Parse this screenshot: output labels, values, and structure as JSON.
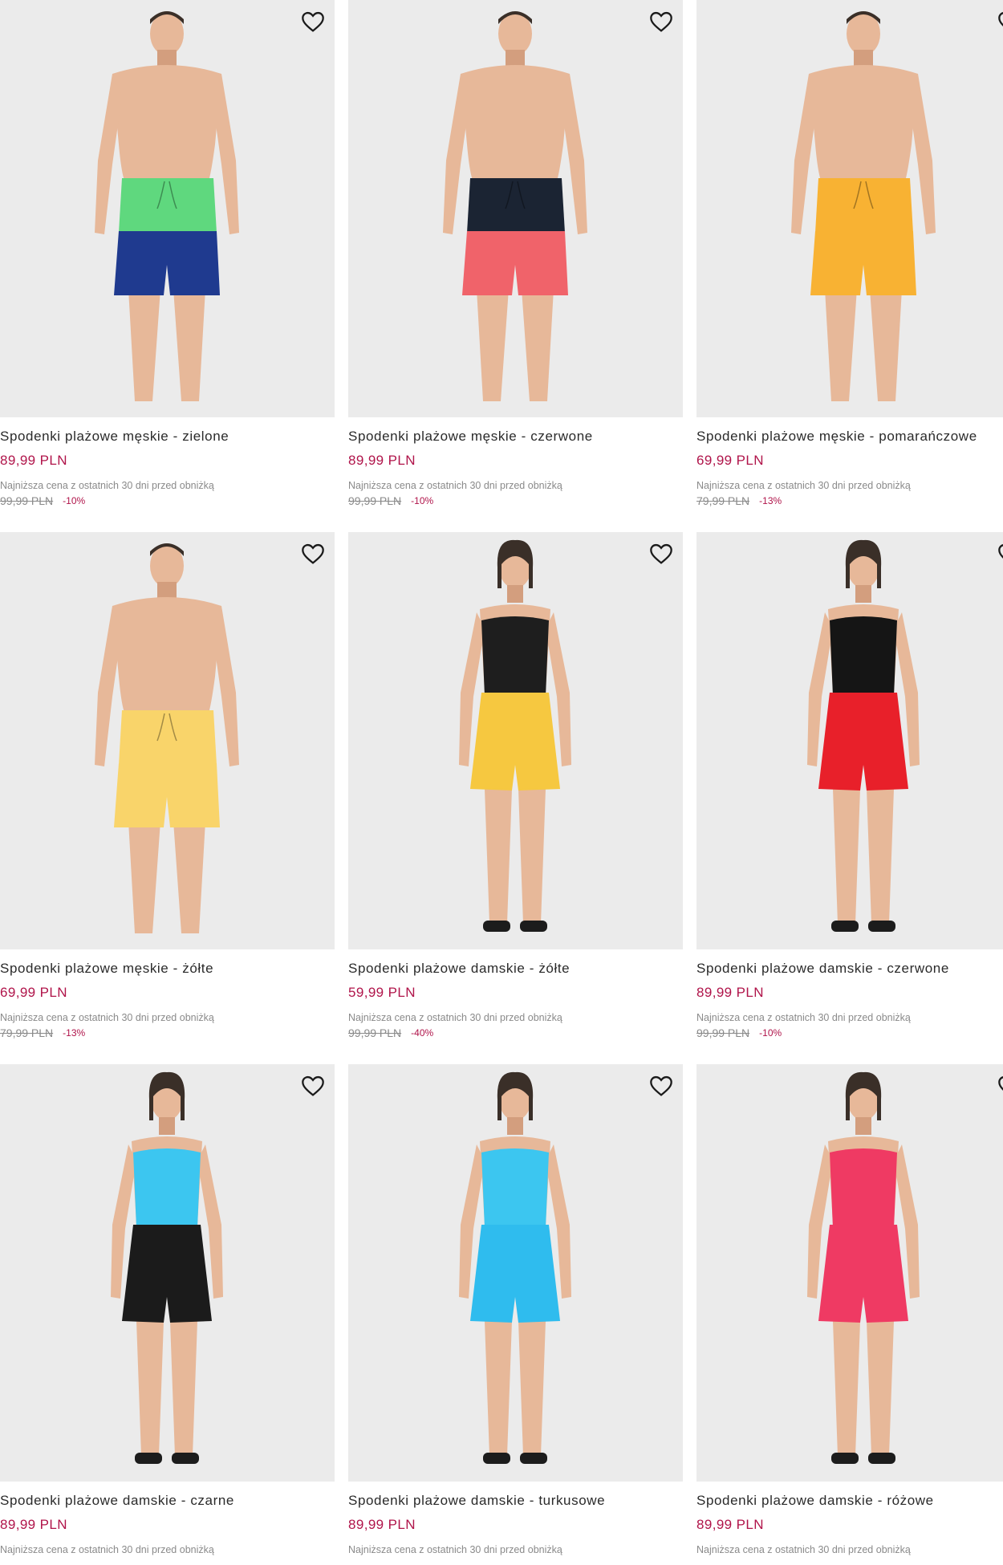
{
  "lowest_label": "Najniższa cena z ostatnich 30 dni przed obniżką",
  "products": [
    {
      "title": "Spodenki plażowe męskie - zielone",
      "price": "89,99 PLN",
      "old_price": "99,99 PLN",
      "discount": "-10%",
      "gender": "male",
      "top_color": "#5fd87e",
      "bottom_color": "#1f3a8f",
      "shirt_color": ""
    },
    {
      "title": "Spodenki plażowe męskie - czerwone",
      "price": "89,99 PLN",
      "old_price": "99,99 PLN",
      "discount": "-10%",
      "gender": "male",
      "top_color": "#1b2433",
      "bottom_color": "#f0636a",
      "shirt_color": ""
    },
    {
      "title": "Spodenki plażowe męskie - pomarańczowe",
      "price": "69,99 PLN",
      "old_price": "79,99 PLN",
      "discount": "-13%",
      "gender": "male",
      "top_color": "#f8b233",
      "bottom_color": "#f8b233",
      "shirt_color": ""
    },
    {
      "title": "Spodenki plażowe męskie - żółte",
      "price": "69,99 PLN",
      "old_price": "79,99 PLN",
      "discount": "-13%",
      "gender": "male",
      "top_color": "#f9d46a",
      "bottom_color": "#f9d46a",
      "shirt_color": ""
    },
    {
      "title": "Spodenki plażowe damskie - żółte",
      "price": "59,99 PLN",
      "old_price": "99,99 PLN",
      "discount": "-40%",
      "gender": "female",
      "top_color": "#f6c840",
      "bottom_color": "#f6c840",
      "shirt_color": "#1e1e1e"
    },
    {
      "title": "Spodenki plażowe damskie - czerwone",
      "price": "89,99 PLN",
      "old_price": "99,99 PLN",
      "discount": "-10%",
      "gender": "female",
      "top_color": "#e8202a",
      "bottom_color": "#e8202a",
      "shirt_color": "#151515"
    },
    {
      "title": "Spodenki plażowe damskie - czarne",
      "price": "89,99 PLN",
      "old_price": "",
      "discount": "",
      "gender": "female",
      "top_color": "#1b1b1b",
      "bottom_color": "#1b1b1b",
      "shirt_color": "#3cc6f0"
    },
    {
      "title": "Spodenki plażowe damskie - turkusowe",
      "price": "89,99 PLN",
      "old_price": "",
      "discount": "",
      "gender": "female",
      "top_color": "#2fbcee",
      "bottom_color": "#2fbcee",
      "shirt_color": "#3cc6f0"
    },
    {
      "title": "Spodenki plażowe damskie - różowe",
      "price": "89,99 PLN",
      "old_price": "",
      "discount": "",
      "gender": "female",
      "top_color": "#ef3a63",
      "bottom_color": "#ef3a63",
      "shirt_color": "#ef3a63"
    }
  ]
}
